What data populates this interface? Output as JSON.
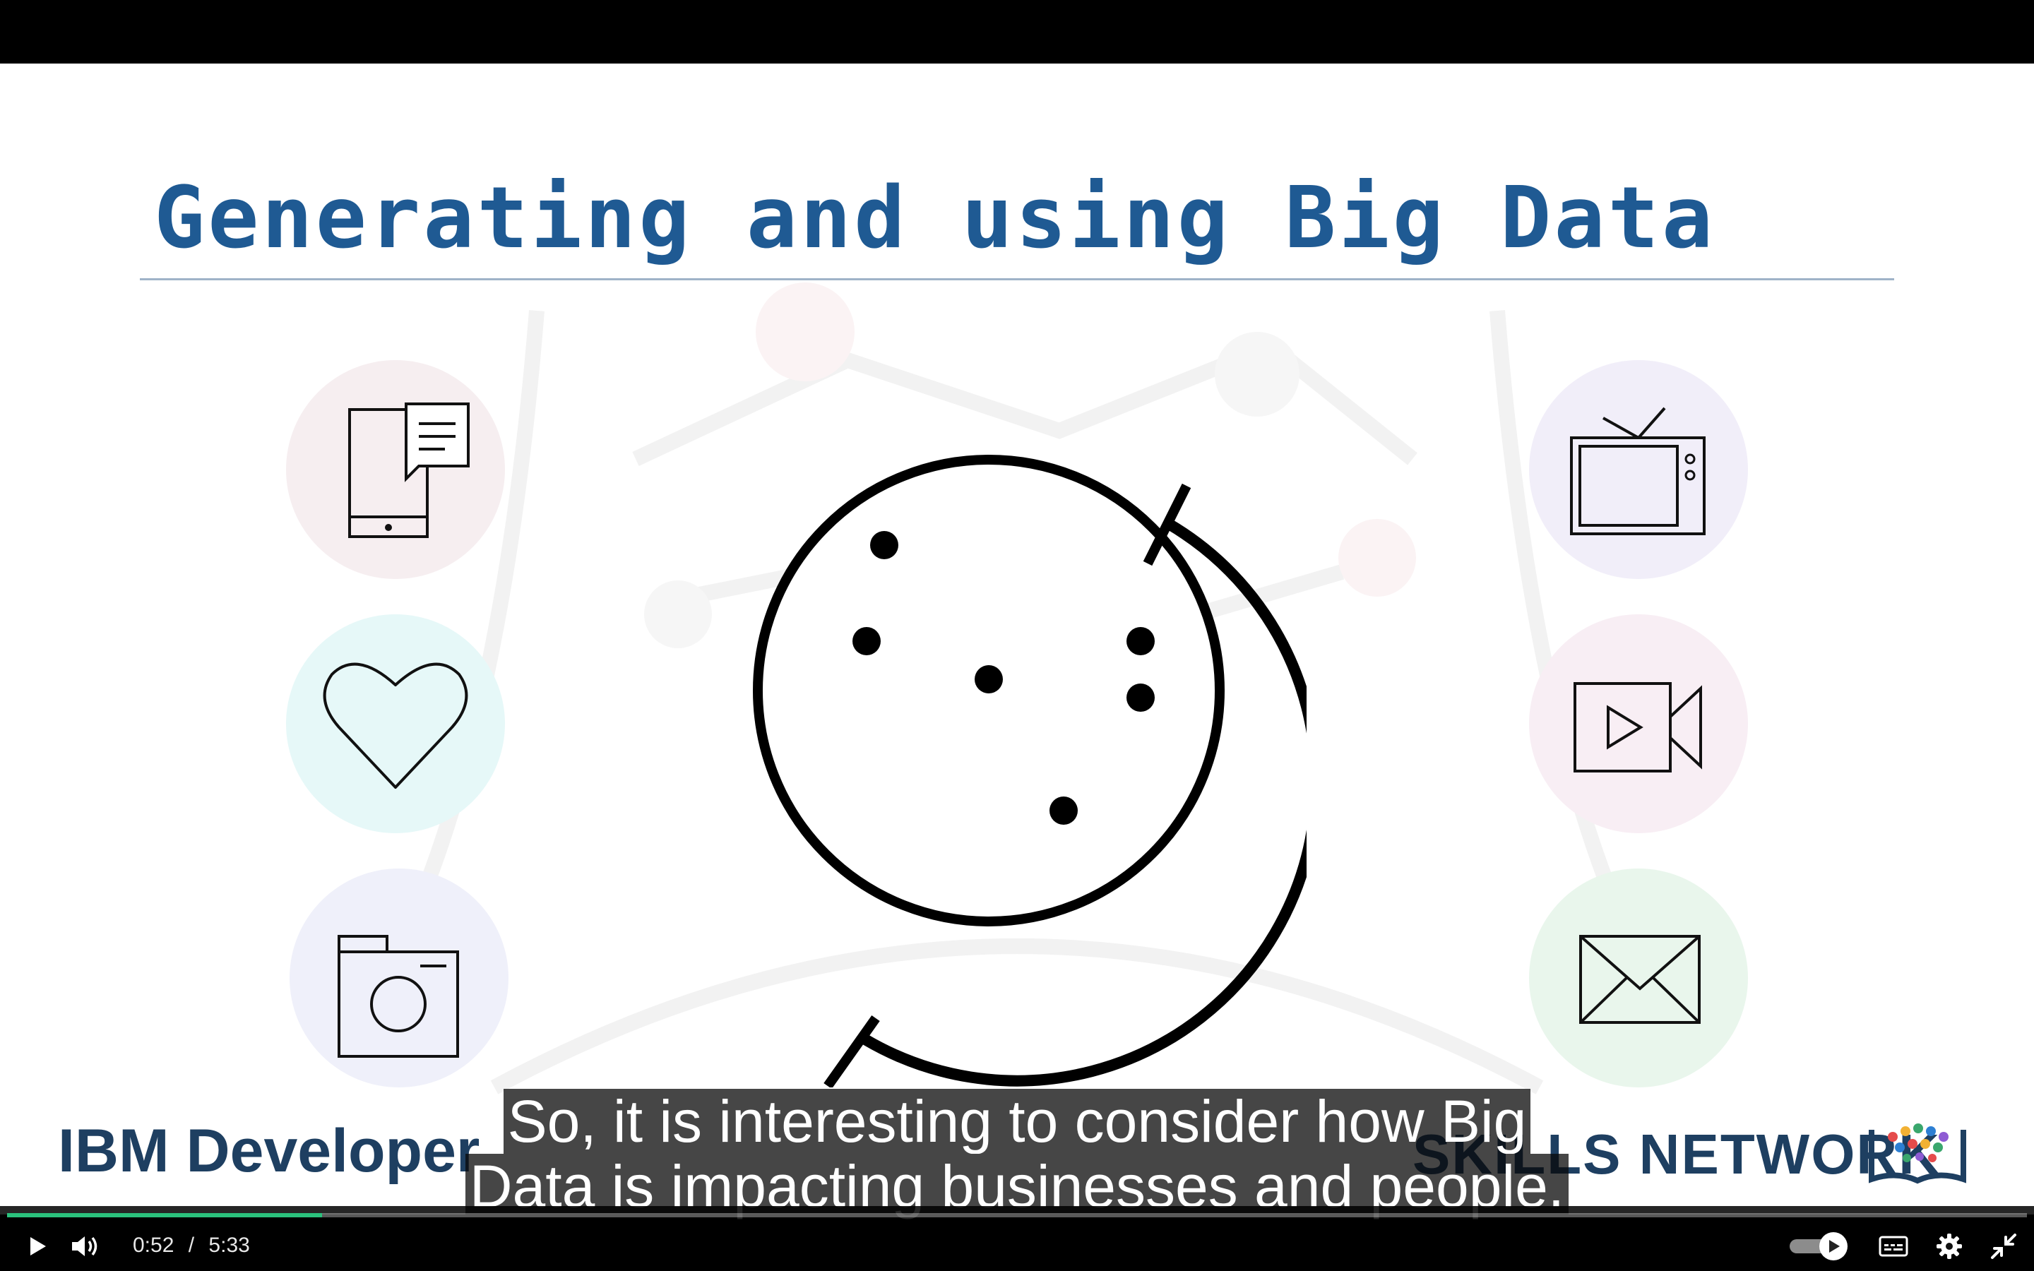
{
  "slide": {
    "title": "Generating and using Big Data",
    "left_icons": [
      "mobile-chat-icon",
      "heart-icon",
      "camera-icon"
    ],
    "right_icons": [
      "television-icon",
      "video-camera-icon",
      "envelope-icon"
    ],
    "center_icon": "globe-icon",
    "brand_left": "IBM Developer",
    "brand_right": "SKILLS NETWORK",
    "colors": {
      "title": "#1f5a93",
      "rule": "#9fb3c8",
      "circle_pink": "#f6eef0",
      "circle_cyan": "#e6f8f8",
      "circle_lavender": "#eff0fa",
      "circle_purple": "#f1eef9",
      "circle_rose": "#f8eef4",
      "circle_green": "#e9f6ec"
    }
  },
  "captions": {
    "line1": "So, it is interesting to consider how Big",
    "line2": "Data is impacting businesses and people."
  },
  "player": {
    "current_time": "0:52",
    "separator": "/",
    "duration": "5:33",
    "progress_fraction": 0.156,
    "accent_color": "#2bc27d",
    "controls": [
      "play-icon",
      "volume-icon",
      "autoplay-toggle",
      "captions-icon",
      "settings-icon",
      "exit-fullscreen-icon"
    ]
  }
}
